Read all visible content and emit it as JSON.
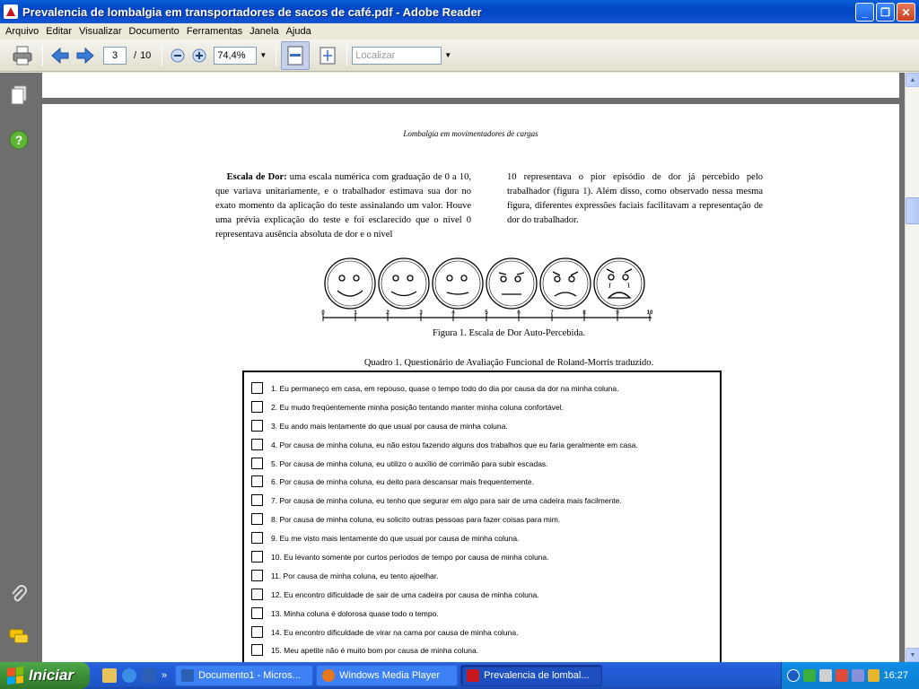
{
  "window": {
    "title": "Prevalencia de lombalgia em transportadores de sacos de café.pdf - Adobe Reader",
    "minimize": "_",
    "maximize": "❐",
    "close": "✕"
  },
  "menu": [
    "Arquivo",
    "Editar",
    "Visualizar",
    "Documento",
    "Ferramentas",
    "Janela",
    "Ajuda"
  ],
  "toolbar": {
    "current_page": "3",
    "page_separator": "/",
    "total_pages": "10",
    "zoom": "74,4%",
    "search_placeholder": "Localizar"
  },
  "document": {
    "running_head": "Lombalgia em movimentadores de cargas",
    "left_col_heading": "Escala de Dor:",
    "left_col_text": " uma escala numérica com graduação de 0 a 10, que variava unitariamente, e o trabalhador estimava sua dor no exato momento da aplicação do teste assinalando um valor. Houve uma prévia explicação do teste e foi esclarecido que o nível 0 representava ausência absoluta de dor e o nível",
    "right_col_text": "10 representava o pior episódio de dor já percebido pelo trabalhador (figura 1). Além disso, como observado nessa mesma figura, diferentes expressões faciais facilitavam a representação de dor do trabalhador.",
    "scale_labels": [
      "0",
      "1",
      "2",
      "3",
      "4",
      "5",
      "6",
      "7",
      "8",
      "9",
      "10"
    ],
    "figure_caption": "Figura 1. Escala de Dor Auto-Percebida.",
    "table_caption": "Quadro 1. Questionário de Avaliação Funcional de Roland-Morris traduzido.",
    "questions": [
      "1. Eu permaneço em casa, em repouso, quase o tempo todo do dia por causa da dor na minha coluna.",
      "2. Eu mudo freqüentemente minha posição tentando manter minha coluna confortável.",
      "3. Eu ando mais lentamente do que usual por causa de minha coluna.",
      "4. Por causa de minha coluna, eu não estou fazendo alguns dos trabalhos que eu faria geralmente em casa.",
      "5. Por causa de minha coluna, eu utilizo o auxílio de corrimão para subir escadas.",
      "6. Por causa de minha coluna, eu deito para descansar mais frequentemente.",
      "7. Por causa de minha coluna, eu tenho que segurar em algo para sair de uma cadeira mais facilmente.",
      "8. Por causa de minha coluna, eu solicito outras pessoas para fazer coisas para mim.",
      "9. Eu me visto mais lentamente do que usual por causa de minha coluna.",
      "10. Eu levanto somente por curtos períodos de tempo por causa de minha coluna.",
      "11. Por causa de minha coluna, eu tento ajoelhar.",
      "12. Eu encontro dificuldade de sair de uma cadeira por causa de minha coluna.",
      "13. Minha coluna é dolorosa quase todo o tempo.",
      "14. Eu encontro dificuldade de virar na cama por causa de minha coluna.",
      "15. Meu apetite não é muito bom por causa de minha coluna."
    ]
  },
  "taskbar": {
    "start_label": "Iniciar",
    "overflow": "»",
    "tasks": [
      {
        "label": "Documento1 - Micros...",
        "icon_color": "#2b5fb4"
      },
      {
        "label": "Windows Media Player",
        "icon_color": "#e8761c"
      },
      {
        "label": "Prevalencia de lombal...",
        "icon_color": "#c8161d"
      }
    ],
    "clock": "16:27"
  },
  "colors": {
    "titlebar": "#0a5fd8",
    "doc_background": "#6e6e6e",
    "taskbar": "#245edb",
    "start_button": "#3c8f36"
  }
}
